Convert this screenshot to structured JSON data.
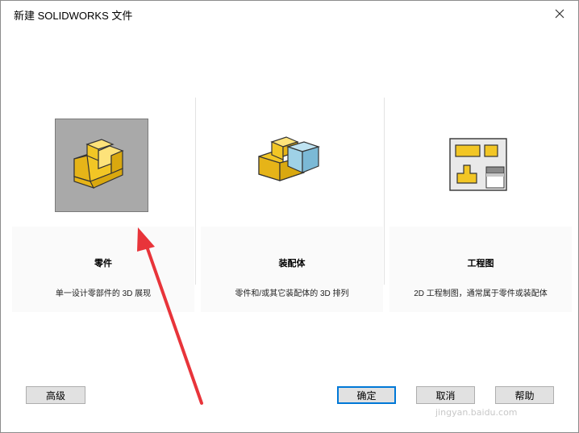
{
  "window": {
    "title": "新建 SOLIDWORKS 文件"
  },
  "templates": [
    {
      "name": "零件",
      "description": "单一设计零部件的 3D 展现",
      "icon": "part-icon",
      "selected": true
    },
    {
      "name": "装配体",
      "description": "零件和/或其它装配体的 3D 排列",
      "icon": "assembly-icon",
      "selected": false
    },
    {
      "name": "工程图",
      "description": "2D 工程制图，通常属于零件或装配体",
      "icon": "drawing-icon",
      "selected": false
    }
  ],
  "buttons": {
    "advanced": "高级",
    "ok": "确定",
    "cancel": "取消",
    "help": "帮助"
  },
  "annotation": {
    "arrow_color": "#e8343a"
  },
  "watermark": {
    "text": "jingyan.baidu.com"
  }
}
